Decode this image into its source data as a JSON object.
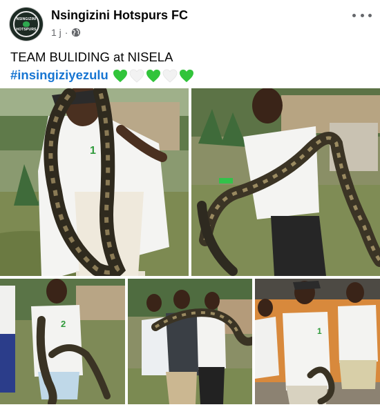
{
  "post": {
    "page_name": "Nsingizini Hotspurs FC",
    "time_ago": "1 j",
    "separator": "·",
    "privacy_icon": "globe-icon",
    "more_icon": "more-horizontal-icon",
    "logo": {
      "top_text": "NSINGIZINI",
      "bottom_text": "HOTSPURS",
      "colors": {
        "background": "#1d2b24",
        "accent": "#2fa84f"
      }
    },
    "caption": {
      "line1": "TEAM BULIDING at NISELA",
      "hashtag": "#insingiziyezulu",
      "emojis": [
        "💚",
        "🤍",
        "💚",
        "🤍",
        "💚"
      ]
    }
  },
  "photos": [
    {
      "subject": "player-holding-python",
      "shirt_number": "1"
    },
    {
      "subject": "player-holding-python"
    },
    {
      "subject": "player-holding-python",
      "shirt_number": "2"
    },
    {
      "subject": "players-with-python"
    },
    {
      "subject": "player-holding-python",
      "shirt_number": "1"
    }
  ],
  "colors": {
    "hashtag": "#1876d2",
    "meta_text": "#65676b",
    "green_heart": "#31c43a",
    "white_heart": "#f2f2f2"
  }
}
